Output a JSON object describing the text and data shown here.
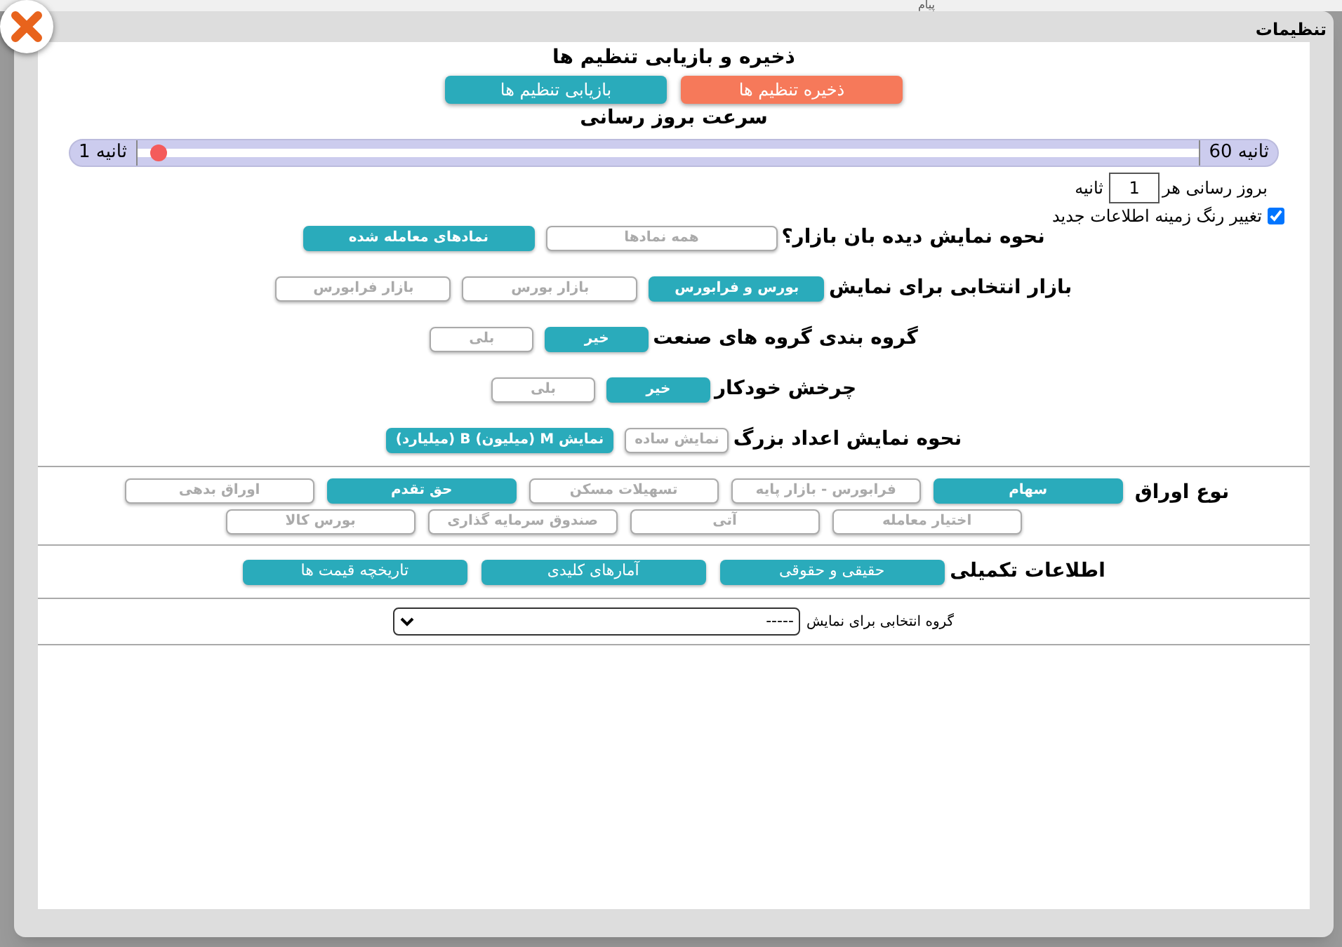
{
  "background": {
    "text": "پیام"
  },
  "window": {
    "title": "تنظیمات"
  },
  "backup": {
    "heading": "ذخیره و بازیابی تنظیم ها",
    "buttons": [
      {
        "label": "ذخیره تنظیم ها",
        "kind": "save"
      },
      {
        "label": "بازیابی تنظیم ها",
        "kind": "restore"
      }
    ]
  },
  "speed": {
    "heading": "سرعت بروز رسانی",
    "max_label": "ثانیه 60",
    "min_label": "ثانیه 1",
    "level": 0.02,
    "prefix": "بروز رسانی هر",
    "value": "1",
    "suffix": "ثانیه"
  },
  "highlight": {
    "label": "تغییر رنگ زمینه اطلاعات جدید",
    "checked": true
  },
  "groups": [
    {
      "label": "نحوه نمایش دیده بان بازار؟",
      "options": [
        {
          "label": "همه نمادها",
          "selected": false
        },
        {
          "label": "نمادهای معامله شده",
          "selected": true
        }
      ]
    },
    {
      "label": "بازار انتخابی برای نمایش",
      "options": [
        {
          "label": "بورس و فرابورس",
          "selected": true
        },
        {
          "label": "بازار بورس",
          "selected": false
        },
        {
          "label": "بازار فرابورس",
          "selected": false
        }
      ]
    },
    {
      "label": "گروه بندی گروه های صنعت",
      "options": [
        {
          "label": "خیر",
          "selected": true
        },
        {
          "label": "بلی",
          "selected": false
        }
      ]
    },
    {
      "label": "چرخش خودکار",
      "options": [
        {
          "label": "خیر",
          "selected": true
        },
        {
          "label": "بلی",
          "selected": false
        }
      ]
    },
    {
      "label": "نحوه نمایش اعداد بزرگ",
      "options": [
        {
          "label": "نمایش ساده",
          "selected": false
        },
        {
          "label": "نمایش M (میلیون) B (میلیارد)",
          "selected": true
        }
      ]
    }
  ],
  "securities": {
    "label": "نوع اوراق",
    "options": [
      {
        "label": "سهام",
        "selected": true
      },
      {
        "label": "فرابورس - بازار پایه",
        "selected": false
      },
      {
        "label": "تسهیلات مسکن",
        "selected": false
      },
      {
        "label": "حق تقدم",
        "selected": true
      },
      {
        "label": "اوراق بدهی",
        "selected": false
      },
      {
        "label": "اختیار معامله",
        "selected": false
      },
      {
        "label": "آتی",
        "selected": false
      },
      {
        "label": "صندوق سرمایه گذاری",
        "selected": false
      },
      {
        "label": "بورس کالا",
        "selected": false
      }
    ]
  },
  "extra": {
    "label": "اطلاعات تکمیلی",
    "buttons": [
      "حقیقی و حقوقی",
      "آمارهای کلیدی",
      "تاریخچه قیمت ها"
    ]
  },
  "group_select": {
    "label": "گروه انتخابی برای نمایش",
    "value": "-----"
  }
}
